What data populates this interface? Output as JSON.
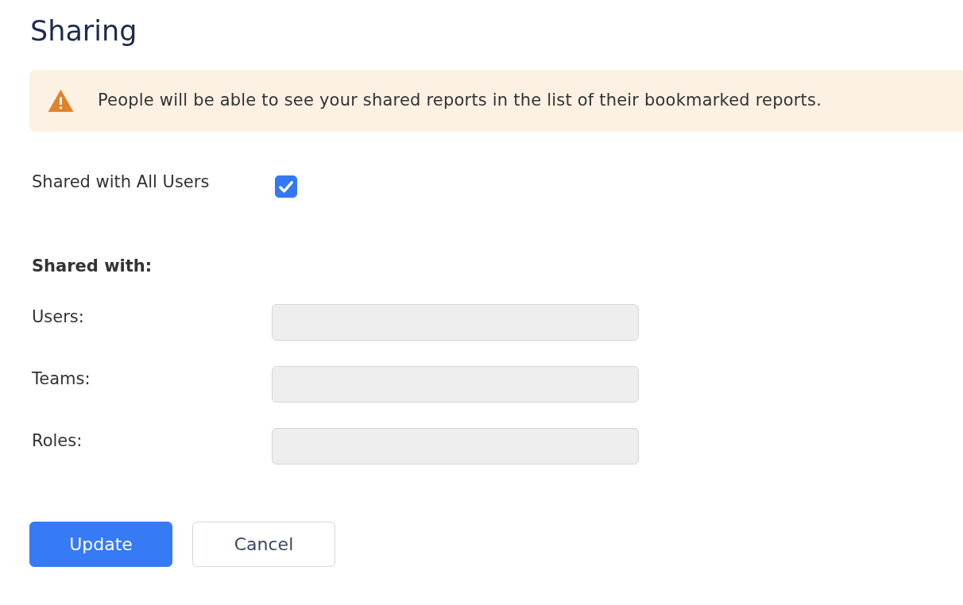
{
  "page": {
    "title": "Sharing"
  },
  "notice": {
    "kind": "warning",
    "text": "People will be able to see your shared reports in the list of their bookmarked reports."
  },
  "share_all": {
    "label": "Shared with All Users",
    "checked": true
  },
  "shared_with": {
    "heading": "Shared with:",
    "fields": [
      {
        "label": "Users:",
        "disabled": true
      },
      {
        "label": "Teams:",
        "disabled": true
      },
      {
        "label": "Roles:",
        "disabled": true
      }
    ]
  },
  "buttons": [
    {
      "label": "Update",
      "kind": "primary"
    },
    {
      "label": "Cancel",
      "kind": "secondary"
    }
  ]
}
